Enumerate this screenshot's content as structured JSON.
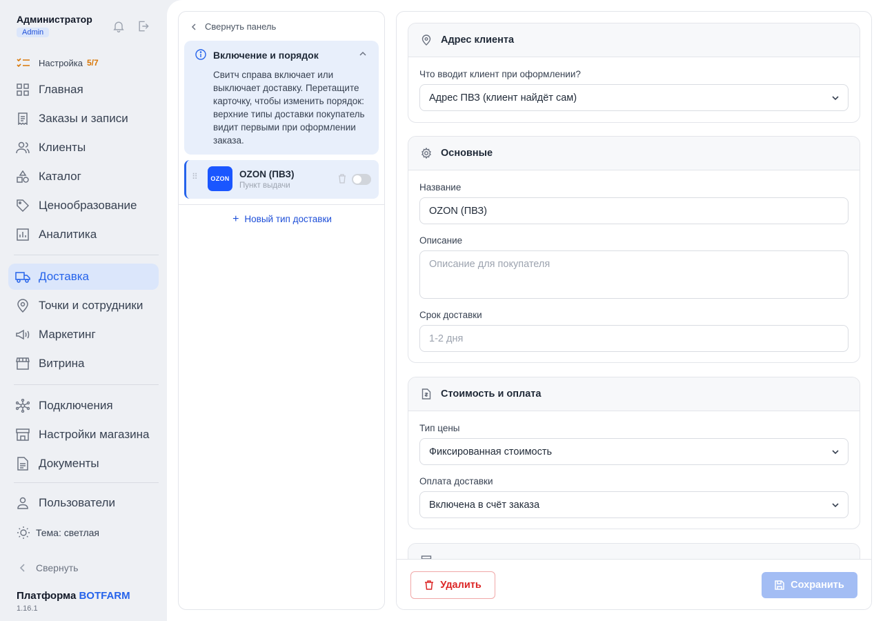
{
  "sidebar": {
    "user_name": "Администратор",
    "user_role": "Admin",
    "setup_label": "Настройка",
    "setup_count": "5/7",
    "nav": [
      {
        "label": "Главная",
        "icon": "grid-icon"
      },
      {
        "label": "Заказы и записи",
        "icon": "receipt-icon"
      },
      {
        "label": "Клиенты",
        "icon": "users-icon"
      },
      {
        "label": "Каталог",
        "icon": "shapes-icon"
      },
      {
        "label": "Ценообразование",
        "icon": "tag-icon"
      },
      {
        "label": "Аналитика",
        "icon": "chart-icon"
      },
      {
        "label": "Доставка",
        "icon": "truck-icon",
        "active": true
      },
      {
        "label": "Точки и сотрудники",
        "icon": "pin-icon"
      },
      {
        "label": "Маркетинг",
        "icon": "megaphone-icon"
      },
      {
        "label": "Витрина",
        "icon": "store-icon"
      },
      {
        "label": "Подключения",
        "icon": "network-icon"
      },
      {
        "label": "Настройки магазина",
        "icon": "shop-icon"
      },
      {
        "label": "Документы",
        "icon": "document-icon"
      },
      {
        "label": "Пользователи",
        "icon": "user-icon"
      }
    ],
    "theme_label": "Тема: светлая",
    "collapse_label": "Свернуть",
    "brand_prefix": "Платформа",
    "brand_name": "BOTFARM",
    "version": "1.16.1"
  },
  "middle": {
    "collapse_label": "Свернуть панель",
    "info_title": "Включение и порядок",
    "info_text": "Свитч справа включает или выключает доставку. Перетащите карточку, чтобы изменить порядок: верхние типы доставки покупатель видит первыми при оформлении заказа.",
    "card": {
      "logo_text": "OZON",
      "name": "OZON (ПВЗ)",
      "subtitle": "Пункт выдачи",
      "enabled": false
    },
    "new_type_label": "Новый тип доставки"
  },
  "right": {
    "address": {
      "title": "Адрес клиента",
      "question": "Что вводит клиент при оформлении?",
      "selected": "Адрес ПВЗ (клиент найдёт сам)"
    },
    "basic": {
      "title": "Основные",
      "name_label": "Название",
      "name_value": "OZON (ПВЗ)",
      "desc_label": "Описание",
      "desc_placeholder": "Описание для покупателя",
      "term_label": "Срок доставки",
      "term_placeholder": "1-2 дня"
    },
    "cost": {
      "title": "Стоимость и оплата",
      "price_type_label": "Тип цены",
      "price_type_value": "Фиксированная стоимость",
      "payment_label": "Оплата доставки",
      "payment_value": "Включена в счёт заказа"
    },
    "delete_label": "Удалить",
    "save_label": "Сохранить"
  },
  "colors": {
    "accent": "#2563eb",
    "danger": "#dc2626",
    "setup_count": "#d97706",
    "ozon_brand": "#1a56ff"
  }
}
